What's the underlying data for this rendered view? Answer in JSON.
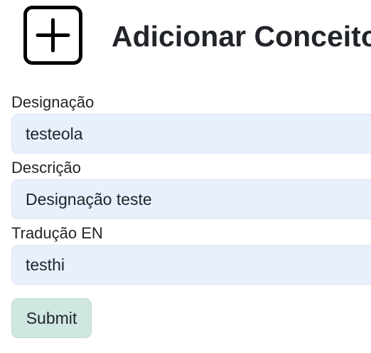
{
  "header": {
    "icon": "plus-square-icon",
    "title": "Adicionar Conceito"
  },
  "form": {
    "designacao": {
      "label": "Designação",
      "value": "testeola"
    },
    "descricao": {
      "label": "Descrição",
      "value": "Designação teste"
    },
    "traducao_en": {
      "label": "Tradução EN",
      "value": "testhi"
    },
    "submit_label": "Submit"
  },
  "colors": {
    "input_background": "#e8f0fe",
    "submit_background": "#cfe6e1",
    "text": "#212529"
  }
}
